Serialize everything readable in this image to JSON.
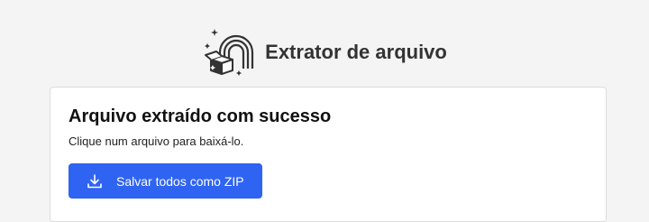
{
  "header": {
    "title": "Extrator de arquivo",
    "logo_icon": "rainbow-box-sparkles-icon"
  },
  "card": {
    "title": "Arquivo extraído com sucesso",
    "subtitle": "Clique num arquivo para baixá-lo.",
    "zip_button_label": "Salvar todos como ZIP",
    "zip_button_icon": "download-icon"
  },
  "colors": {
    "background": "#f4f4f4",
    "card_background": "#ffffff",
    "accent": "#2f63f2",
    "text": "#111111"
  }
}
